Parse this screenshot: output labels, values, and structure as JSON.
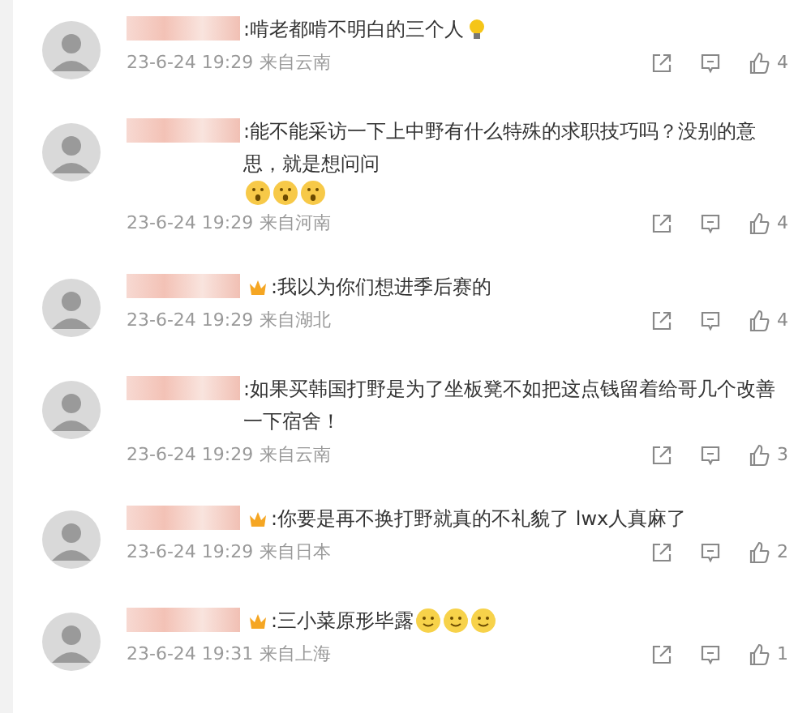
{
  "comments": [
    {
      "crown": false,
      "text": ":啃老都啃不明白的三个人",
      "emojis": [
        {
          "kind": "bulb"
        }
      ],
      "time": "23-6-24 19:29",
      "location": "来自云南",
      "likes": "4"
    },
    {
      "crown": false,
      "text": ":能不能采访一下上中野有什么特殊的求职技巧吗？没别的意思，就是想问问",
      "emojis": [
        {
          "kind": "shock"
        },
        {
          "kind": "shock"
        },
        {
          "kind": "shock"
        }
      ],
      "time": "23-6-24 19:29",
      "location": "来自河南",
      "likes": "4"
    },
    {
      "crown": true,
      "text": ":我以为你们想进季后赛的",
      "time": "23-6-24 19:29",
      "location": "来自湖北",
      "likes": "4"
    },
    {
      "crown": false,
      "text": ":如果买韩国打野是为了坐板凳不如把这点钱留着给哥几个改善一下宿舍！",
      "time": "23-6-24 19:29",
      "location": "来自云南",
      "likes": "3"
    },
    {
      "crown": true,
      "text": ":你要是再不换打野就真的不礼貌了 lwx人真麻了",
      "time": "23-6-24 19:29",
      "location": "来自日本",
      "likes": "2"
    },
    {
      "crown": true,
      "text": ":三小菜原形毕露",
      "emojis": [
        {
          "kind": "smile"
        },
        {
          "kind": "smile"
        },
        {
          "kind": "smile"
        }
      ],
      "time": "23-6-24 19:31",
      "location": "来自上海",
      "likes": "1"
    }
  ]
}
